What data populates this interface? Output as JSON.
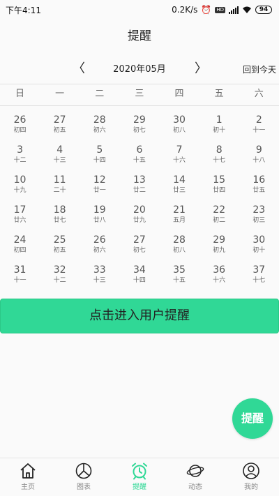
{
  "status_bar": {
    "time": "下午4:11",
    "speed": "0.2K/s",
    "hd": "HD",
    "net": "4G",
    "battery": "94"
  },
  "header": {
    "title": "提醒"
  },
  "month_nav": {
    "prev": "〈",
    "label": "2020年05月",
    "next": "〉",
    "today": "回到今天"
  },
  "weekdays": [
    "日",
    "一",
    "二",
    "三",
    "四",
    "五",
    "六"
  ],
  "calendar": [
    [
      {
        "d": "26",
        "l": "初四"
      },
      {
        "d": "27",
        "l": "初五"
      },
      {
        "d": "28",
        "l": "初六"
      },
      {
        "d": "29",
        "l": "初七"
      },
      {
        "d": "30",
        "l": "初八"
      },
      {
        "d": "1",
        "l": "初十"
      },
      {
        "d": "2",
        "l": "十一"
      }
    ],
    [
      {
        "d": "3",
        "l": "十二"
      },
      {
        "d": "4",
        "l": "十三"
      },
      {
        "d": "5",
        "l": "十四"
      },
      {
        "d": "6",
        "l": "十五"
      },
      {
        "d": "7",
        "l": "十六"
      },
      {
        "d": "8",
        "l": "十七"
      },
      {
        "d": "9",
        "l": "十八"
      }
    ],
    [
      {
        "d": "10",
        "l": "十九"
      },
      {
        "d": "11",
        "l": "二十"
      },
      {
        "d": "12",
        "l": "廿一"
      },
      {
        "d": "13",
        "l": "廿二"
      },
      {
        "d": "14",
        "l": "廿三"
      },
      {
        "d": "15",
        "l": "廿四"
      },
      {
        "d": "16",
        "l": "廿五"
      }
    ],
    [
      {
        "d": "17",
        "l": "廿六"
      },
      {
        "d": "18",
        "l": "廿七"
      },
      {
        "d": "19",
        "l": "廿八"
      },
      {
        "d": "20",
        "l": "廿九"
      },
      {
        "d": "21",
        "l": "五月"
      },
      {
        "d": "22",
        "l": "初二"
      },
      {
        "d": "23",
        "l": "初三"
      }
    ],
    [
      {
        "d": "24",
        "l": "初四"
      },
      {
        "d": "25",
        "l": "初五"
      },
      {
        "d": "26",
        "l": "初六"
      },
      {
        "d": "27",
        "l": "初七"
      },
      {
        "d": "28",
        "l": "初八"
      },
      {
        "d": "29",
        "l": "初九"
      },
      {
        "d": "30",
        "l": "初十"
      }
    ],
    [
      {
        "d": "31",
        "l": "十一"
      },
      {
        "d": "32",
        "l": "十二"
      },
      {
        "d": "33",
        "l": "十三"
      },
      {
        "d": "34",
        "l": "十四"
      },
      {
        "d": "35",
        "l": "十五"
      },
      {
        "d": "36",
        "l": "十六"
      },
      {
        "d": "37",
        "l": "十七"
      }
    ]
  ],
  "main": {
    "enter_button": "点击进入用户提醒"
  },
  "fab": {
    "label": "提醒"
  },
  "colors": {
    "accent": "#30d896"
  },
  "tabs": [
    {
      "label": "主页",
      "icon": "home-icon",
      "active": false
    },
    {
      "label": "图表",
      "icon": "pie-chart-icon",
      "active": false
    },
    {
      "label": "提醒",
      "icon": "alarm-clock-icon",
      "active": true
    },
    {
      "label": "动态",
      "icon": "planet-icon",
      "active": false
    },
    {
      "label": "我的",
      "icon": "user-icon",
      "active": false
    }
  ]
}
